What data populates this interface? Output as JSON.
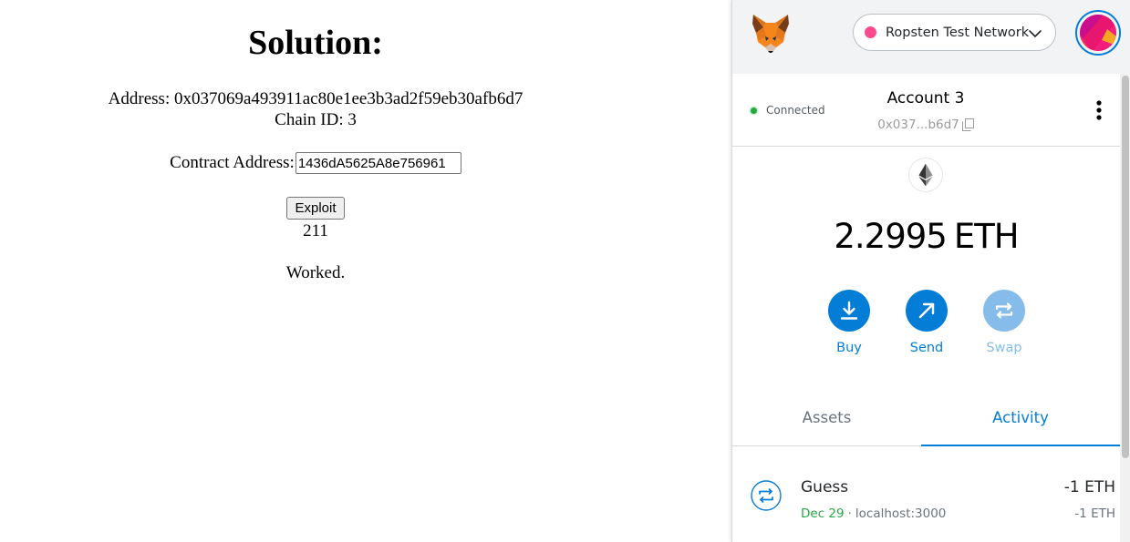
{
  "page": {
    "title": "Solution:",
    "address_line": "Address: 0x037069a493911ac80e1ee3b3ad2f59eb30afb6d7",
    "chain_line": "Chain ID: 3",
    "contract_label": "Contract Address:",
    "contract_value": "1436dA5625A8e756961",
    "exploit_label": "Exploit",
    "result_value": "211",
    "status_message": "Worked."
  },
  "metamask": {
    "network": {
      "label": "Ropsten Test Network",
      "dot_color": "#ff4a8d"
    },
    "connection": {
      "label": "Connected",
      "dot_color": "#28a745"
    },
    "account": {
      "name": "Account 3",
      "short_address": "0x037...b6d7"
    },
    "balance": {
      "amount": "2.2995",
      "unit": "ETH"
    },
    "actions": {
      "buy": "Buy",
      "send": "Send",
      "swap": "Swap"
    },
    "tabs": {
      "assets": "Assets",
      "activity": "Activity",
      "selected": "Activity"
    },
    "activity": [
      {
        "title": "Guess",
        "date": "Dec 29",
        "separator": "·",
        "origin": "localhost:3000",
        "amount": "-1 ETH",
        "amount_secondary": "-1 ETH",
        "icon": "swap-arrows-icon"
      }
    ],
    "colors": {
      "accent": "#037dd6",
      "accent_disabled": "#86bcea",
      "header_bg": "#f2f3f4",
      "success": "#28a745"
    },
    "icons": {
      "logo": "metamask-fox-icon",
      "network_chevron": "chevron-down-icon",
      "copy": "copy-icon",
      "menu": "kebab-menu-icon",
      "token": "ethereum-icon",
      "buy": "download-icon",
      "send": "arrow-up-right-icon",
      "swap": "swap-arrows-icon"
    }
  }
}
